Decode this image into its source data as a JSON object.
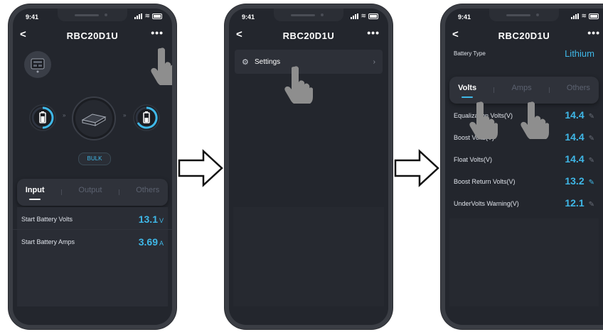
{
  "status": {
    "time": "9:41"
  },
  "screens": [
    {
      "title": "RBC20D1U",
      "mode_badge": "BULK",
      "tabs": [
        "Input",
        "Output",
        "Others"
      ],
      "active_tab": "Input",
      "rows": [
        {
          "label": "Start Battery Volts",
          "value": "13.1",
          "unit": "V"
        },
        {
          "label": "Start Battery Amps",
          "value": "3.69",
          "unit": "A"
        }
      ],
      "icons": [
        "back-icon",
        "more-icon",
        "device-icon",
        "start-battery-icon",
        "charger-icon",
        "house-battery-icon",
        "hand-pointer-icon"
      ]
    },
    {
      "title": "RBC20D1U",
      "menu": [
        {
          "label": "Settings",
          "icon": "gear-icon"
        }
      ]
    },
    {
      "title": "RBC20D1U",
      "battery_type": {
        "label": "Battery Type",
        "value": "Lithium"
      },
      "tabs": [
        "Volts",
        "Amps",
        "Others"
      ],
      "active_tab": "Volts",
      "rows": [
        {
          "label": "Equalization Volts(V)",
          "value": "14.4"
        },
        {
          "label": "Boost Volts(V)",
          "value": "14.4"
        },
        {
          "label": "Float Volts(V)",
          "value": "14.4"
        },
        {
          "label": "Boost Return Volts(V)",
          "value": "13.2"
        },
        {
          "label": "UnderVolts Warning(V)",
          "value": "12.1"
        }
      ]
    }
  ],
  "colors": {
    "accent": "#3fb8e8",
    "screen_bg": "#23262d",
    "phone_frame": "#3a3d44",
    "hand": "#8e8e8e"
  }
}
